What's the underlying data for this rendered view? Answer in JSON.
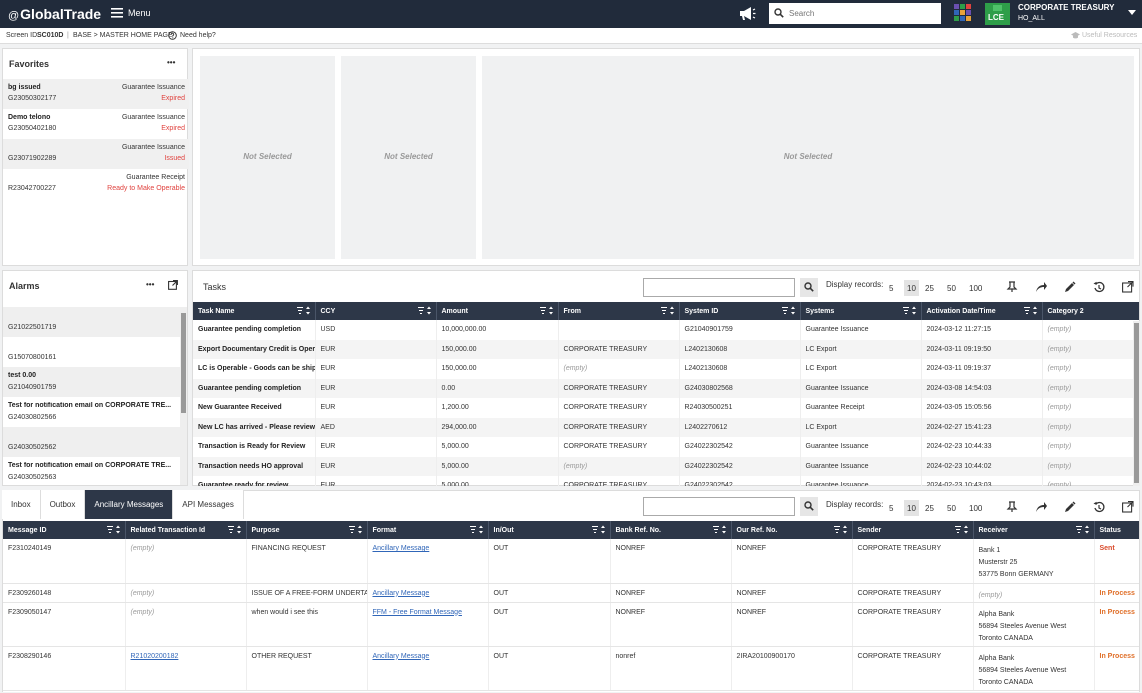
{
  "header": {
    "logo_prefix": "@",
    "logo_text": "GlobalTrade",
    "menu_label": "Menu",
    "search_placeholder": "Search",
    "company_badge": "LCE",
    "company_name": "CORPORATE TREASURY",
    "company_sub": "HO_ALL",
    "app_grid_colors": [
      "#6a4fb0",
      "#2e9e49",
      "#e0433f",
      "#3066b8",
      "#e8a23a",
      "#6a4fb0",
      "#2e9e49",
      "#3066b8",
      "#e8a23a"
    ]
  },
  "infobar": {
    "screen_label": "Screen ID:",
    "screen_id": "SC010D",
    "breadcrumb": "BASE > MASTER HOME PAGE",
    "help": "Need help?",
    "useful": "Useful Resources"
  },
  "favorites": {
    "title": "Favorites",
    "more": "•••",
    "items": [
      {
        "name": "bg issued",
        "ref": "G23050302177",
        "type": "Guarantee Issuance",
        "status": "Expired"
      },
      {
        "name": "Demo telono",
        "ref": "G23050402180",
        "type": "Guarantee Issuance",
        "status": "Expired"
      },
      {
        "name": "",
        "ref": "G23071902289",
        "type": "Guarantee Issuance",
        "status": "Issued"
      },
      {
        "name": "",
        "ref": "R23042700227",
        "type": "Guarantee Receipt",
        "status": "Ready to Make Operable"
      }
    ]
  },
  "not_selected": [
    "Not Selected",
    "Not Selected",
    "Not Selected"
  ],
  "alarms": {
    "title": "Alarms",
    "more": "•••",
    "items": [
      {
        "name": "",
        "ref": "G21022501719"
      },
      {
        "name": "",
        "ref": "G15070800161"
      },
      {
        "name": "test 0.00",
        "ref": "G21040901759"
      },
      {
        "name": "Test for notification email on CORPORATE TRE...",
        "ref": "G24030802566"
      },
      {
        "name": "",
        "ref": "G24030502562"
      },
      {
        "name": "Test for notification email on CORPORATE TRE...",
        "ref": "G24030502563"
      }
    ]
  },
  "pager": {
    "display_label": "Display records:",
    "sizes": [
      "5",
      "10",
      "25",
      "50",
      "100"
    ],
    "selected": "10"
  },
  "tasks": {
    "title": "Tasks",
    "columns": [
      "Task Name",
      "CCY",
      "Amount",
      "From",
      "System ID",
      "Systems",
      "Activation Date/Time",
      "Category 2"
    ],
    "rows": [
      [
        "Guarantee pending completion",
        "USD",
        "10,000,000.00",
        "",
        "G21040901759",
        "Guarantee Issuance",
        "2024-03-12 11:27:15",
        "(empty)"
      ],
      [
        "Export Documentary Credit is Operable",
        "EUR",
        "150,000.00",
        "CORPORATE TREASURY",
        "L2402130608",
        "LC Export",
        "2024-03-11 09:19:50",
        "(empty)"
      ],
      [
        "LC is Operable - Goods can be shipped",
        "EUR",
        "150,000.00",
        "(empty)",
        "L2402130608",
        "LC Export",
        "2024-03-11 09:19:37",
        "(empty)"
      ],
      [
        "Guarantee pending completion",
        "EUR",
        "0.00",
        "CORPORATE TREASURY",
        "G24030802568",
        "Guarantee Issuance",
        "2024-03-08 14:54:03",
        "(empty)"
      ],
      [
        "New Guarantee Received",
        "EUR",
        "1,200.00",
        "CORPORATE TREASURY",
        "R24030500251",
        "Guarantee Receipt",
        "2024-03-05 15:05:56",
        "(empty)"
      ],
      [
        "New LC has arrived - Please review",
        "AED",
        "294,000.00",
        "CORPORATE TREASURY",
        "L2402270612",
        "LC Export",
        "2024-02-27 15:41:23",
        "(empty)"
      ],
      [
        "Transaction is Ready for Review",
        "EUR",
        "5,000.00",
        "CORPORATE TREASURY",
        "G24022302542",
        "Guarantee Issuance",
        "2024-02-23 10:44:33",
        "(empty)"
      ],
      [
        "Transaction needs HO approval",
        "EUR",
        "5,000.00",
        "(empty)",
        "G24022302542",
        "Guarantee Issuance",
        "2024-02-23 10:44:02",
        "(empty)"
      ],
      [
        "Guarantee ready for review",
        "EUR",
        "5,000.00",
        "CORPORATE TREASURY",
        "G24022302542",
        "Guarantee Issuance",
        "2024-02-23 10:43:03",
        "(empty)"
      ]
    ]
  },
  "messages": {
    "tabs": [
      "Inbox",
      "Outbox",
      "Ancillary Messages",
      "API Messages"
    ],
    "active_tab": 2,
    "columns": [
      "Message ID",
      "Related Transaction Id",
      "Purpose",
      "Format",
      "In/Out",
      "Bank Ref. No.",
      "Our Ref. No.",
      "Sender",
      "Receiver",
      "Status"
    ],
    "rows": [
      {
        "id": "F2310240149",
        "related": "(empty)",
        "purpose": "FINANCING REQUEST",
        "format": "Ancillary Message",
        "inout": "OUT",
        "bank_ref": "NONREF",
        "our_ref": "NONREF",
        "sender": "CORPORATE TREASURY",
        "receiver": [
          "Bank 1",
          "Musterstr 25",
          "53775 Bonn GERMANY"
        ],
        "status": "Sent"
      },
      {
        "id": "F2309260148",
        "related": "(empty)",
        "purpose": "ISSUE OF A FREE-FORM UNDERTAKING",
        "format": "Ancillary Message",
        "inout": "OUT",
        "bank_ref": "NONREF",
        "our_ref": "NONREF",
        "sender": "CORPORATE TREASURY",
        "receiver": [
          "(empty)"
        ],
        "status": "In Process"
      },
      {
        "id": "F2309050147",
        "related": "(empty)",
        "purpose": "when would i see this",
        "format": "FFM - Free Format Message",
        "inout": "OUT",
        "bank_ref": "NONREF",
        "our_ref": "NONREF",
        "sender": "CORPORATE TREASURY",
        "receiver": [
          "Alpha Bank",
          "56894 Steeles Avenue West",
          "Toronto CANADA"
        ],
        "status": "In Process"
      },
      {
        "id": "F2308290146",
        "related": "R21020200182",
        "purpose": "OTHER REQUEST",
        "format": "Ancillary Message",
        "inout": "OUT",
        "bank_ref": "nonref",
        "our_ref": "2IRA20100900170",
        "sender": "CORPORATE TREASURY",
        "receiver": [
          "Alpha Bank",
          "56894 Steeles Avenue West",
          "Toronto CANADA"
        ],
        "status": "In Process"
      }
    ]
  }
}
